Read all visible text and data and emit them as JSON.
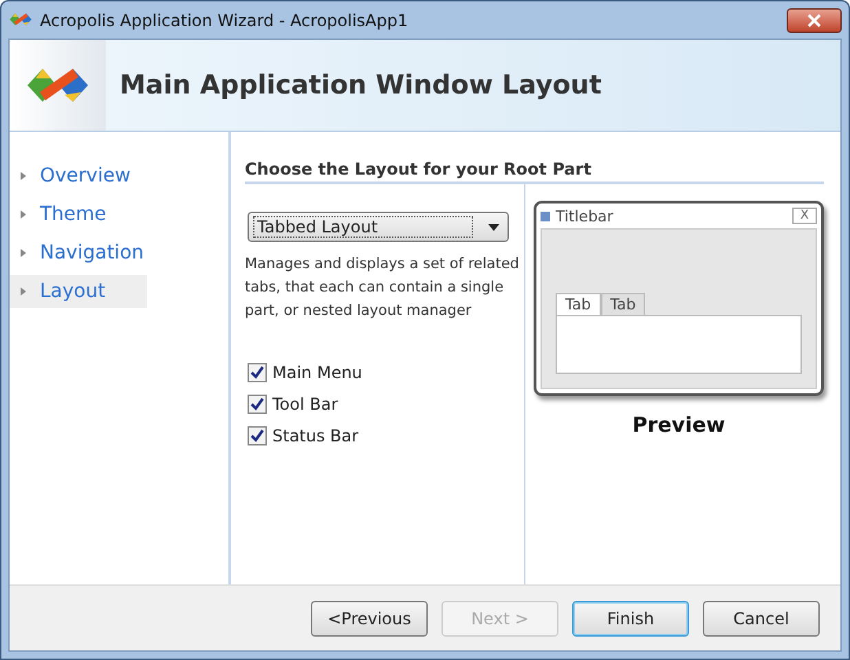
{
  "window": {
    "title": "Acropolis Application Wizard - AcropolisApp1"
  },
  "header": {
    "title": "Main Application Window Layout"
  },
  "sidebar": {
    "items": [
      {
        "label": "Overview",
        "selected": false
      },
      {
        "label": "Theme",
        "selected": false
      },
      {
        "label": "Navigation",
        "selected": false
      },
      {
        "label": "Layout",
        "selected": true
      }
    ]
  },
  "section_title": "Choose the Layout for your Root Part",
  "layout_dropdown": {
    "value": "Tabbed Layout"
  },
  "description": "Manages and displays a set of related tabs, that each can contain a single part, or nested layout manager",
  "options": [
    {
      "label": "Main Menu",
      "checked": true
    },
    {
      "label": "Tool Bar",
      "checked": true
    },
    {
      "label": "Status Bar",
      "checked": true
    }
  ],
  "preview": {
    "window_title": "Titlebar",
    "close": "X",
    "tabs": [
      {
        "label": "Tab",
        "selected": true
      },
      {
        "label": "Tab",
        "selected": false
      }
    ],
    "caption": "Preview"
  },
  "buttons": [
    {
      "label": "<Previous",
      "disabled": false,
      "default": false
    },
    {
      "label": "Next >",
      "disabled": true,
      "default": false
    },
    {
      "label": "Finish",
      "disabled": false,
      "default": true
    },
    {
      "label": "Cancel",
      "disabled": false,
      "default": false
    }
  ]
}
